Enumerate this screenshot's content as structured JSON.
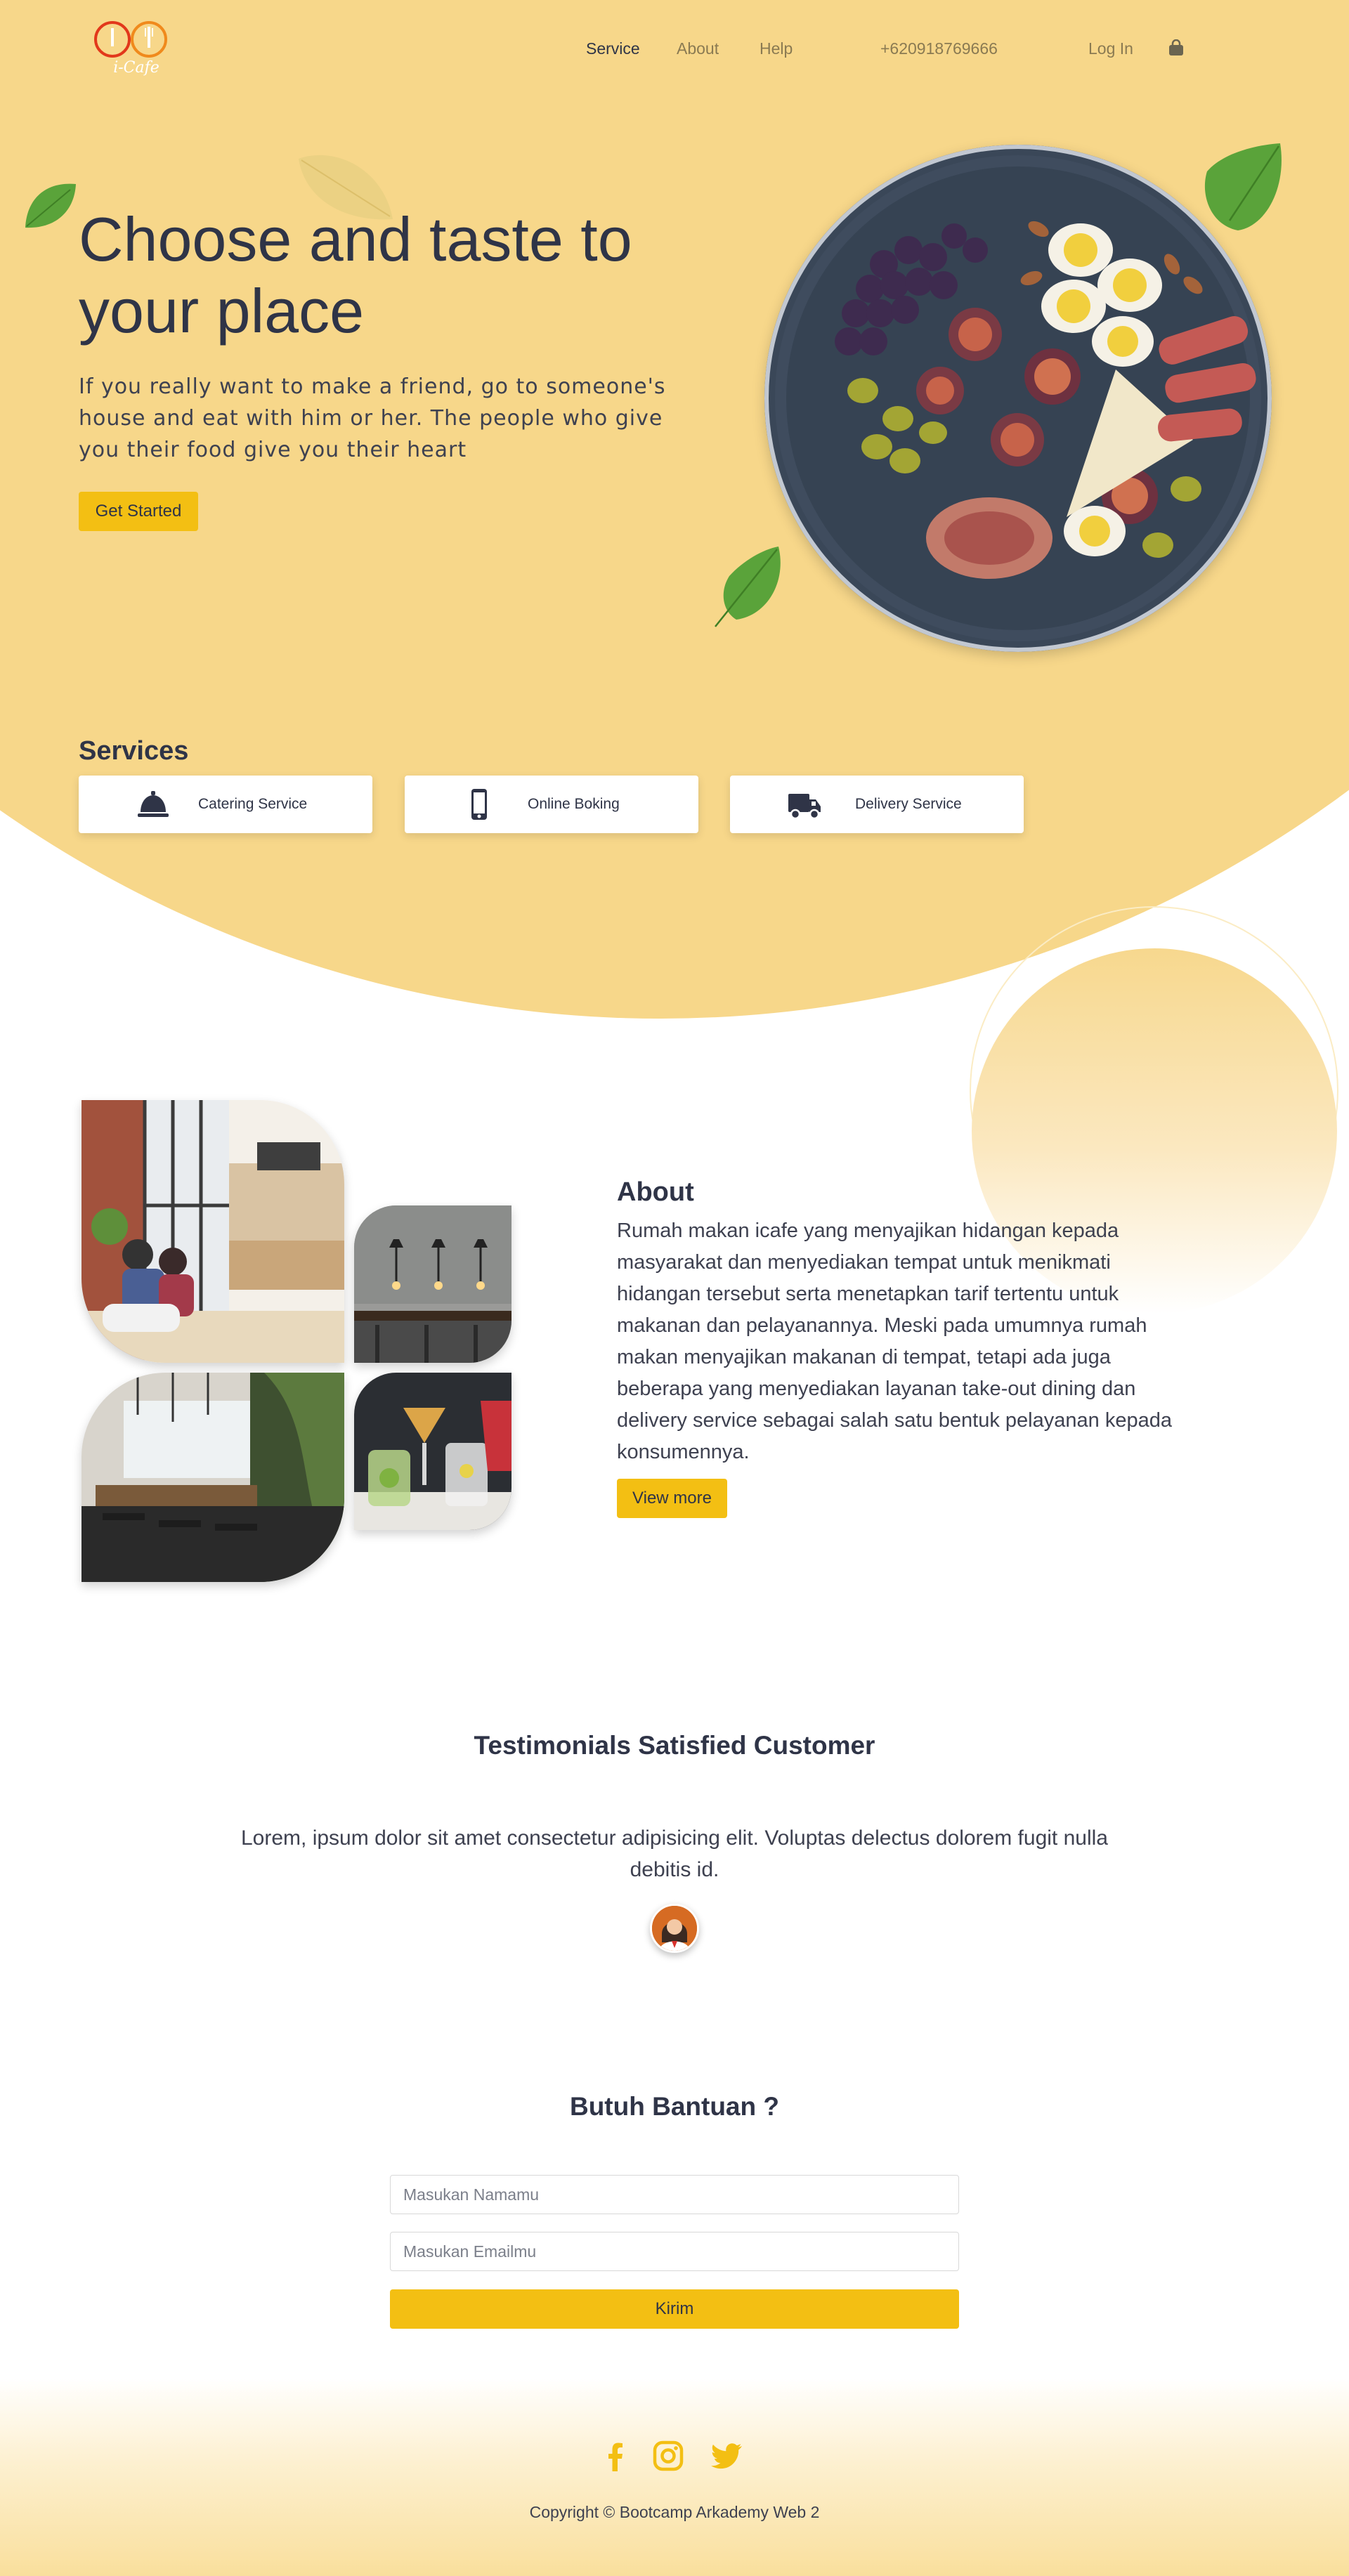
{
  "brand": {
    "logo_text": "i-Cafe"
  },
  "nav": {
    "items": [
      {
        "label": "Service",
        "active": true
      },
      {
        "label": "About",
        "active": false
      },
      {
        "label": "Help",
        "active": false
      }
    ],
    "phone": "+620918769666",
    "login": "Log In",
    "cart_icon": "shopping-bag-icon"
  },
  "hero": {
    "title": "Choose and taste to your place",
    "text": "If you really want to make a friend, go to someone's house and eat with him or her. The people who give you their food give you their heart",
    "cta": "Get Started"
  },
  "services": {
    "title": "Services",
    "items": [
      {
        "label": "Catering Service",
        "icon": "service-bell-icon"
      },
      {
        "label": "Online Boking",
        "icon": "mobile-phone-icon"
      },
      {
        "label": "Delivery Service",
        "icon": "delivery-truck-icon"
      }
    ]
  },
  "about": {
    "title": "About",
    "text": "Rumah makan icafe yang menyajikan hidangan kepada masyarakat dan menyediakan tempat untuk menikmati hidangan tersebut serta menetapkan tarif tertentu untuk makanan dan pelayanannya. Meski pada umumnya rumah makan menyajikan makanan di tempat, tetapi ada juga beberapa yang menyediakan layanan take-out dining dan delivery service sebagai salah satu bentuk pelayanan kepada konsumennya.",
    "cta": "View more"
  },
  "testimonials": {
    "title": "Testimonials Satisfied Customer",
    "quote": "Lorem, ipsum dolor sit amet consectetur adipisicing elit. Voluptas delectus dolorem fugit nulla debitis id."
  },
  "contact": {
    "title": "Butuh Bantuan ?",
    "name_placeholder": "Masukan Namamu",
    "email_placeholder": "Masukan Emailmu",
    "submit": "Kirim"
  },
  "footer": {
    "social": [
      "facebook-icon",
      "instagram-icon",
      "twitter-icon"
    ],
    "copyright": "Copyright © Bootcamp Arkademy Web 2"
  },
  "colors": {
    "hero_bg": "#f7d78a",
    "accent": "#f3bf13",
    "text_dark": "#2f3447",
    "leaf_green": "#5aa33a"
  }
}
